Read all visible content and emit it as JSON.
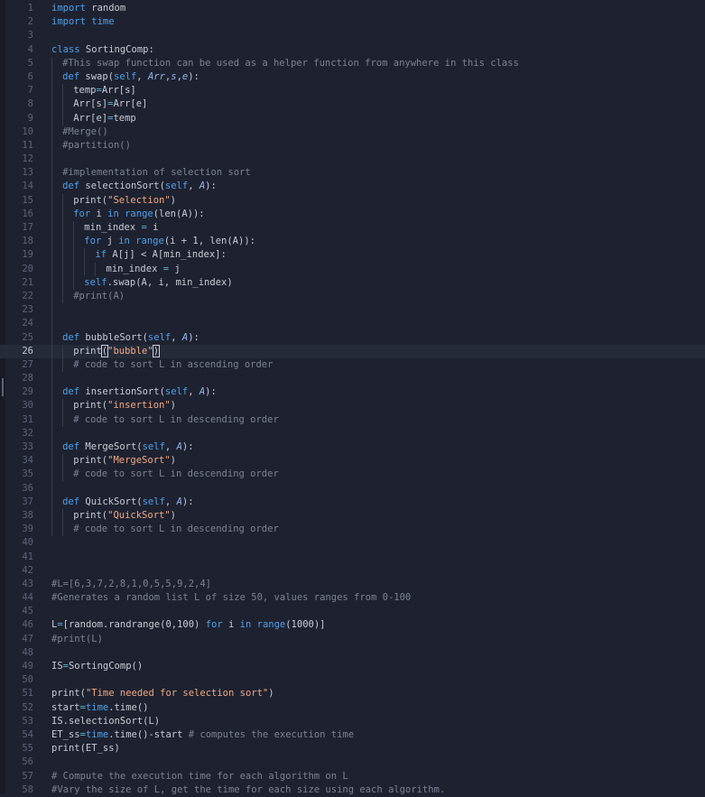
{
  "editor": {
    "current_line": 26,
    "lines": [
      {
        "n": "1",
        "tokens": [
          [
            "kw",
            "import"
          ],
          [
            "plain",
            " random"
          ]
        ]
      },
      {
        "n": "2",
        "tokens": [
          [
            "kw",
            "import"
          ],
          [
            "plain",
            " "
          ],
          [
            "kw",
            "time"
          ]
        ]
      },
      {
        "n": "3",
        "tokens": []
      },
      {
        "n": "4",
        "tokens": [
          [
            "kw",
            "class"
          ],
          [
            "plain",
            " SortingComp:"
          ]
        ]
      },
      {
        "n": "5",
        "indent": 1,
        "tokens": [
          [
            "cm",
            "#This swap function can be used as a helper function from anywhere in this class"
          ]
        ]
      },
      {
        "n": "6",
        "indent": 1,
        "tokens": [
          [
            "kw",
            "def"
          ],
          [
            "plain",
            " swap("
          ],
          [
            "self",
            "self"
          ],
          [
            "plain",
            ", "
          ],
          [
            "param",
            "Arr"
          ],
          [
            "plain",
            ","
          ],
          [
            "param",
            "s"
          ],
          [
            "plain",
            ","
          ],
          [
            "param",
            "e"
          ],
          [
            "plain",
            "):"
          ]
        ]
      },
      {
        "n": "7",
        "indent": 2,
        "tokens": [
          [
            "plain",
            "temp"
          ],
          [
            "eq",
            "="
          ],
          [
            "plain",
            "Arr[s]"
          ]
        ]
      },
      {
        "n": "8",
        "indent": 2,
        "tokens": [
          [
            "plain",
            "Arr[s]"
          ],
          [
            "eq",
            "="
          ],
          [
            "plain",
            "Arr[e]"
          ]
        ]
      },
      {
        "n": "9",
        "indent": 2,
        "tokens": [
          [
            "plain",
            "Arr[e]"
          ],
          [
            "eq",
            "="
          ],
          [
            "plain",
            "temp"
          ]
        ]
      },
      {
        "n": "10",
        "indent": 1,
        "tokens": [
          [
            "cm",
            "#Merge()"
          ]
        ]
      },
      {
        "n": "11",
        "indent": 1,
        "tokens": [
          [
            "cm",
            "#partition()"
          ]
        ]
      },
      {
        "n": "12",
        "guides": 1,
        "tokens": []
      },
      {
        "n": "13",
        "indent": 1,
        "tokens": [
          [
            "cm",
            "#implementation of selection sort"
          ]
        ]
      },
      {
        "n": "14",
        "indent": 1,
        "tokens": [
          [
            "kw",
            "def"
          ],
          [
            "plain",
            " selectionSort("
          ],
          [
            "self",
            "self"
          ],
          [
            "plain",
            ", "
          ],
          [
            "param",
            "A"
          ],
          [
            "plain",
            "):"
          ]
        ]
      },
      {
        "n": "15",
        "indent": 2,
        "tokens": [
          [
            "plain",
            "print("
          ],
          [
            "str",
            "\"Selection\""
          ],
          [
            "plain",
            ")"
          ]
        ]
      },
      {
        "n": "16",
        "indent": 2,
        "tokens": [
          [
            "kw",
            "for"
          ],
          [
            "plain",
            " i "
          ],
          [
            "kw",
            "in"
          ],
          [
            "plain",
            " "
          ],
          [
            "kw",
            "range"
          ],
          [
            "plain",
            "(len(A)):"
          ]
        ]
      },
      {
        "n": "17",
        "indent": 3,
        "tokens": [
          [
            "plain",
            "min_index "
          ],
          [
            "eq",
            "="
          ],
          [
            "plain",
            " i"
          ]
        ]
      },
      {
        "n": "18",
        "indent": 3,
        "tokens": [
          [
            "kw",
            "for"
          ],
          [
            "plain",
            " j "
          ],
          [
            "kw",
            "in"
          ],
          [
            "plain",
            " "
          ],
          [
            "kw",
            "range"
          ],
          [
            "plain",
            "(i + 1, len(A)):"
          ]
        ]
      },
      {
        "n": "19",
        "indent": 4,
        "tokens": [
          [
            "kw",
            "if"
          ],
          [
            "plain",
            " A[j] < A[min_index]:"
          ]
        ]
      },
      {
        "n": "20",
        "indent": 5,
        "tokens": [
          [
            "plain",
            "min_index "
          ],
          [
            "eq",
            "="
          ],
          [
            "plain",
            " j"
          ]
        ]
      },
      {
        "n": "21",
        "indent": 3,
        "tokens": [
          [
            "self",
            "self"
          ],
          [
            "plain",
            ".swap(A, i, min_index)"
          ]
        ]
      },
      {
        "n": "22",
        "indent": 2,
        "tokens": [
          [
            "cm",
            "#print(A)"
          ]
        ]
      },
      {
        "n": "23",
        "guides": 1,
        "tokens": []
      },
      {
        "n": "24",
        "guides": 1,
        "tokens": []
      },
      {
        "n": "25",
        "indent": 1,
        "tokens": [
          [
            "kw",
            "def"
          ],
          [
            "plain",
            " bubbleSort("
          ],
          [
            "self",
            "self"
          ],
          [
            "plain",
            ", "
          ],
          [
            "param",
            "A"
          ],
          [
            "plain",
            "):"
          ]
        ]
      },
      {
        "n": "26",
        "indent": 2,
        "tokens": [
          [
            "plain",
            "print"
          ],
          [
            "cursor",
            "("
          ],
          [
            "str",
            "\"bubble\""
          ],
          [
            "cursor",
            ")"
          ]
        ]
      },
      {
        "n": "27",
        "indent": 2,
        "tokens": [
          [
            "cm",
            "# code to sort L in ascending order"
          ]
        ]
      },
      {
        "n": "28",
        "guides": 1,
        "tokens": []
      },
      {
        "n": "29",
        "indent": 1,
        "tokens": [
          [
            "kw",
            "def"
          ],
          [
            "plain",
            " insertionSort("
          ],
          [
            "self",
            "self"
          ],
          [
            "plain",
            ", "
          ],
          [
            "param",
            "A"
          ],
          [
            "plain",
            "):"
          ]
        ]
      },
      {
        "n": "30",
        "indent": 2,
        "tokens": [
          [
            "plain",
            "print("
          ],
          [
            "str",
            "\"insertion\""
          ],
          [
            "plain",
            ")"
          ]
        ]
      },
      {
        "n": "31",
        "indent": 2,
        "tokens": [
          [
            "cm",
            "# code to sort L in descending order"
          ]
        ]
      },
      {
        "n": "32",
        "guides": 1,
        "tokens": []
      },
      {
        "n": "33",
        "indent": 1,
        "tokens": [
          [
            "kw",
            "def"
          ],
          [
            "plain",
            " MergeSort("
          ],
          [
            "self",
            "self"
          ],
          [
            "plain",
            ", "
          ],
          [
            "param",
            "A"
          ],
          [
            "plain",
            "):"
          ]
        ]
      },
      {
        "n": "34",
        "indent": 2,
        "tokens": [
          [
            "plain",
            "print("
          ],
          [
            "str",
            "\"MergeSort\""
          ],
          [
            "plain",
            ")"
          ]
        ]
      },
      {
        "n": "35",
        "indent": 2,
        "tokens": [
          [
            "cm",
            "# code to sort L in descending order"
          ]
        ]
      },
      {
        "n": "36",
        "guides": 1,
        "tokens": []
      },
      {
        "n": "37",
        "indent": 1,
        "tokens": [
          [
            "kw",
            "def"
          ],
          [
            "plain",
            " QuickSort("
          ],
          [
            "self",
            "self"
          ],
          [
            "plain",
            ", "
          ],
          [
            "param",
            "A"
          ],
          [
            "plain",
            "):"
          ]
        ]
      },
      {
        "n": "38",
        "indent": 2,
        "tokens": [
          [
            "plain",
            "print("
          ],
          [
            "str",
            "\"QuickSort\""
          ],
          [
            "plain",
            ")"
          ]
        ]
      },
      {
        "n": "39",
        "indent": 2,
        "tokens": [
          [
            "cm",
            "# code to sort L in descending order"
          ]
        ]
      },
      {
        "n": "40",
        "tokens": []
      },
      {
        "n": "41",
        "tokens": []
      },
      {
        "n": "42",
        "tokens": []
      },
      {
        "n": "43",
        "tokens": [
          [
            "cm",
            "#L=[6,3,7,2,8,1,0,5,5,9,2,4]"
          ]
        ]
      },
      {
        "n": "44",
        "tokens": [
          [
            "cm",
            "#Generates a random list L of size 50, values ranges from 0-100"
          ]
        ]
      },
      {
        "n": "45",
        "tokens": []
      },
      {
        "n": "46",
        "tokens": [
          [
            "plain",
            "L"
          ],
          [
            "eq",
            "="
          ],
          [
            "plain",
            "[random.randrange(0,100) "
          ],
          [
            "kw",
            "for"
          ],
          [
            "plain",
            " i "
          ],
          [
            "kw",
            "in"
          ],
          [
            "plain",
            " "
          ],
          [
            "kw",
            "range"
          ],
          [
            "plain",
            "(1000)]"
          ]
        ]
      },
      {
        "n": "47",
        "tokens": [
          [
            "cm",
            "#print(L)"
          ]
        ]
      },
      {
        "n": "48",
        "tokens": []
      },
      {
        "n": "49",
        "tokens": [
          [
            "plain",
            "IS"
          ],
          [
            "eq",
            "="
          ],
          [
            "plain",
            "SortingComp()"
          ]
        ]
      },
      {
        "n": "50",
        "tokens": []
      },
      {
        "n": "51",
        "tokens": [
          [
            "plain",
            "print("
          ],
          [
            "str",
            "\"Time needed for selection sort\""
          ],
          [
            "plain",
            ")"
          ]
        ]
      },
      {
        "n": "52",
        "tokens": [
          [
            "plain",
            "start"
          ],
          [
            "eq",
            "="
          ],
          [
            "kw",
            "time"
          ],
          [
            "plain",
            ".time()"
          ]
        ]
      },
      {
        "n": "53",
        "tokens": [
          [
            "plain",
            "IS.selectionSort(L)"
          ]
        ]
      },
      {
        "n": "54",
        "tokens": [
          [
            "plain",
            "ET_ss"
          ],
          [
            "eq",
            "="
          ],
          [
            "kw",
            "time"
          ],
          [
            "plain",
            ".time()-start "
          ],
          [
            "cm",
            "# computes the execution time"
          ]
        ]
      },
      {
        "n": "55",
        "tokens": [
          [
            "plain",
            "print(ET_ss)"
          ]
        ]
      },
      {
        "n": "56",
        "tokens": []
      },
      {
        "n": "57",
        "tokens": [
          [
            "cm",
            "# Compute the execution time for each algorithm on L"
          ]
        ]
      },
      {
        "n": "58",
        "tokens": [
          [
            "cm",
            "#Vary the size of L, get the time for each size using each algorithm."
          ]
        ]
      }
    ]
  },
  "colors": {
    "background": "#1e2230",
    "keyword": "#4fa0e8",
    "string": "#f0a882",
    "comment": "#7c8294",
    "line_number": "#5d6378",
    "current_line": "#262b3a"
  }
}
